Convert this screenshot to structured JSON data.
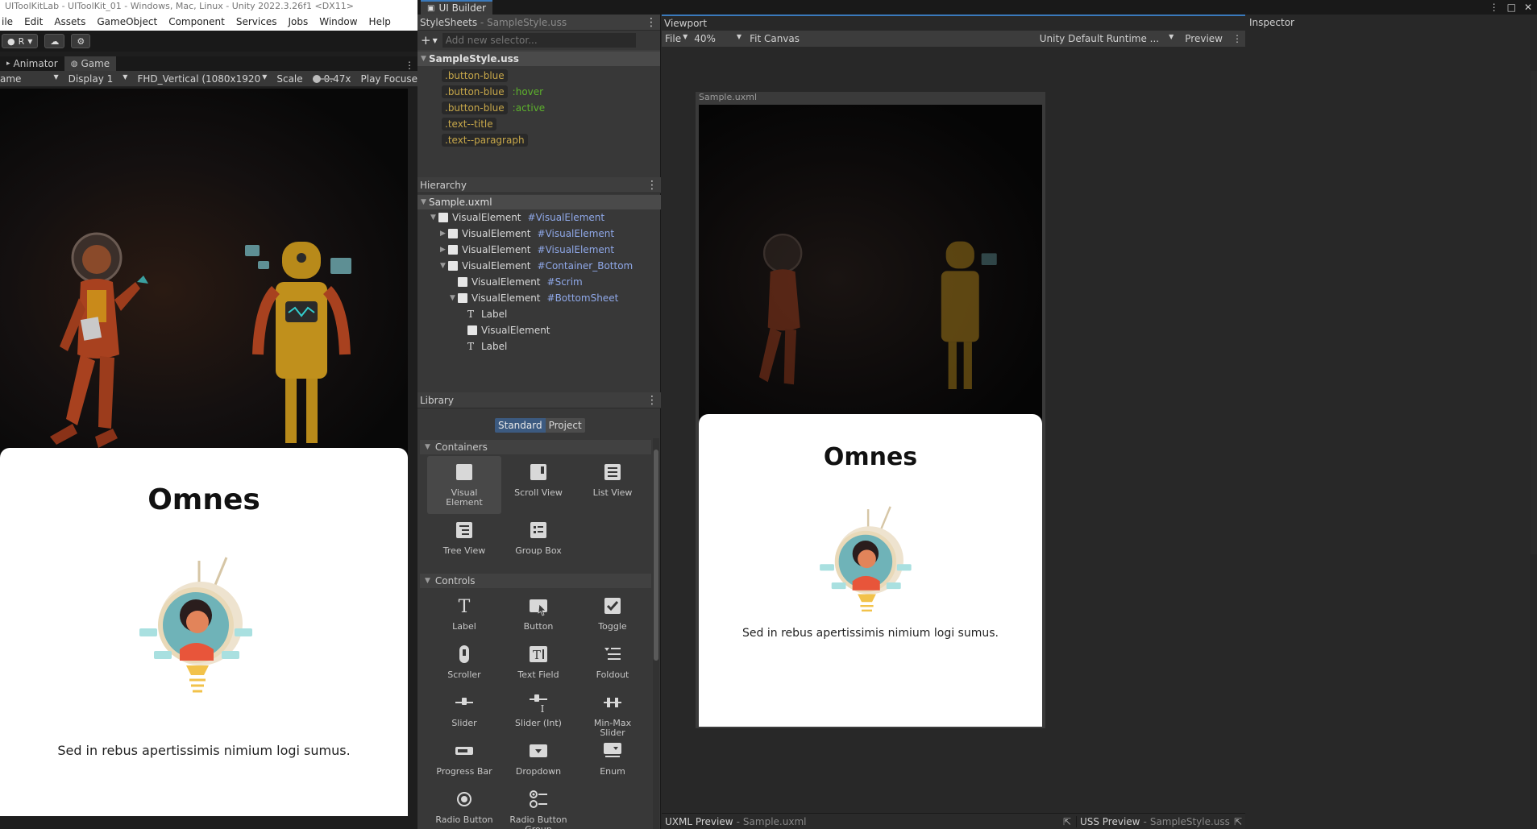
{
  "unity": {
    "title": "UIToolKitLab - UIToolKit_01 - Windows, Mac, Linux - Unity 2022.3.26f1 <DX11>",
    "menu": [
      "ile",
      "Edit",
      "Assets",
      "GameObject",
      "Component",
      "Services",
      "Jobs",
      "Window",
      "Help"
    ],
    "account_label": "R",
    "tabs": [
      {
        "label": "Animator",
        "active": false
      },
      {
        "label": "Game",
        "active": true
      }
    ],
    "game_toolbar": {
      "view_mode": "ame",
      "display": "Display 1",
      "resolution": "FHD_Vertical (1080x1920",
      "scale_label": "Scale",
      "scale_value": "0.47x",
      "play_focus": "Play Focuse"
    }
  },
  "sample": {
    "title": "Omnes",
    "paragraph": "Sed in rebus apertissimis nimium logi sumus."
  },
  "ui_builder": {
    "window_tab": "UI Builder",
    "stylesheets": {
      "header": "StyleSheets",
      "file": "SampleStyle.uss",
      "add_selector_placeholder": "Add new selector...",
      "root": "SampleStyle.uss",
      "selectors": [
        {
          "name": ".button-blue",
          "pseudo": ""
        },
        {
          "name": ".button-blue",
          "pseudo": ":hover"
        },
        {
          "name": ".button-blue",
          "pseudo": ":active"
        },
        {
          "name": ".text--title",
          "pseudo": ""
        },
        {
          "name": ".text--paragraph",
          "pseudo": ""
        }
      ]
    },
    "hierarchy": {
      "header": "Hierarchy",
      "root": "Sample.uxml",
      "items": [
        {
          "name": "VisualElement",
          "id": "#VisualElement",
          "depth": 1,
          "expand": "open",
          "kind": "box"
        },
        {
          "name": "VisualElement",
          "id": "#VisualElement",
          "depth": 2,
          "expand": "closed",
          "kind": "box"
        },
        {
          "name": "VisualElement",
          "id": "#VisualElement",
          "depth": 2,
          "expand": "closed",
          "kind": "box"
        },
        {
          "name": "VisualElement",
          "id": "#Container_Bottom",
          "depth": 2,
          "expand": "open",
          "kind": "box"
        },
        {
          "name": "VisualElement",
          "id": "#Scrim",
          "depth": 3,
          "expand": "none",
          "kind": "box"
        },
        {
          "name": "VisualElement",
          "id": "#BottomSheet",
          "depth": 3,
          "expand": "open",
          "kind": "box"
        },
        {
          "name": "Label",
          "id": "",
          "depth": 4,
          "expand": "none",
          "kind": "text"
        },
        {
          "name": "VisualElement",
          "id": "",
          "depth": 4,
          "expand": "none",
          "kind": "box"
        },
        {
          "name": "Label",
          "id": "",
          "depth": 4,
          "expand": "none",
          "kind": "text"
        }
      ]
    },
    "library": {
      "header": "Library",
      "tabs": [
        "Standard",
        "Project"
      ],
      "containers_label": "Containers",
      "containers": [
        {
          "label": "Visual Element",
          "icon": "visual-element-icon"
        },
        {
          "label": "Scroll View",
          "icon": "scroll-view-icon"
        },
        {
          "label": "List View",
          "icon": "list-view-icon"
        },
        {
          "label": "Tree View",
          "icon": "tree-view-icon"
        },
        {
          "label": "Group Box",
          "icon": "group-box-icon"
        }
      ],
      "controls_label": "Controls",
      "controls": [
        {
          "label": "Label",
          "icon": "label-icon"
        },
        {
          "label": "Button",
          "icon": "button-icon"
        },
        {
          "label": "Toggle",
          "icon": "toggle-icon"
        },
        {
          "label": "Scroller",
          "icon": "scroller-icon"
        },
        {
          "label": "Text Field",
          "icon": "text-field-icon"
        },
        {
          "label": "Foldout",
          "icon": "foldout-icon"
        },
        {
          "label": "Slider",
          "icon": "slider-icon"
        },
        {
          "label": "Slider (Int)",
          "icon": "slider-int-icon"
        },
        {
          "label": "Min-Max Slider",
          "icon": "min-max-slider-icon"
        },
        {
          "label": "Progress Bar",
          "icon": "progress-bar-icon"
        },
        {
          "label": "Dropdown",
          "icon": "dropdown-icon"
        },
        {
          "label": "Enum",
          "icon": "enum-icon"
        },
        {
          "label": "Radio Button",
          "icon": "radio-button-icon"
        },
        {
          "label": "Radio Button Group",
          "icon": "radio-group-icon"
        }
      ]
    },
    "viewport": {
      "header": "Viewport",
      "file_menu": "File",
      "zoom": "40%",
      "fit_canvas": "Fit Canvas",
      "theme": "Unity Default Runtime ...",
      "preview": "Preview",
      "canvas_label": "Sample.uxml",
      "uxml_preview_label": "UXML Preview",
      "uxml_preview_file": "Sample.uxml",
      "uss_preview_label": "USS Preview",
      "uss_preview_file": "SampleStyle.uss"
    },
    "inspector": {
      "header": "Inspector"
    }
  },
  "colors": {
    "accent": "#3a79bb",
    "selector_text": "#c8a84a",
    "pseudo_text": "#5db22c",
    "id_text": "#8fa8e8"
  }
}
